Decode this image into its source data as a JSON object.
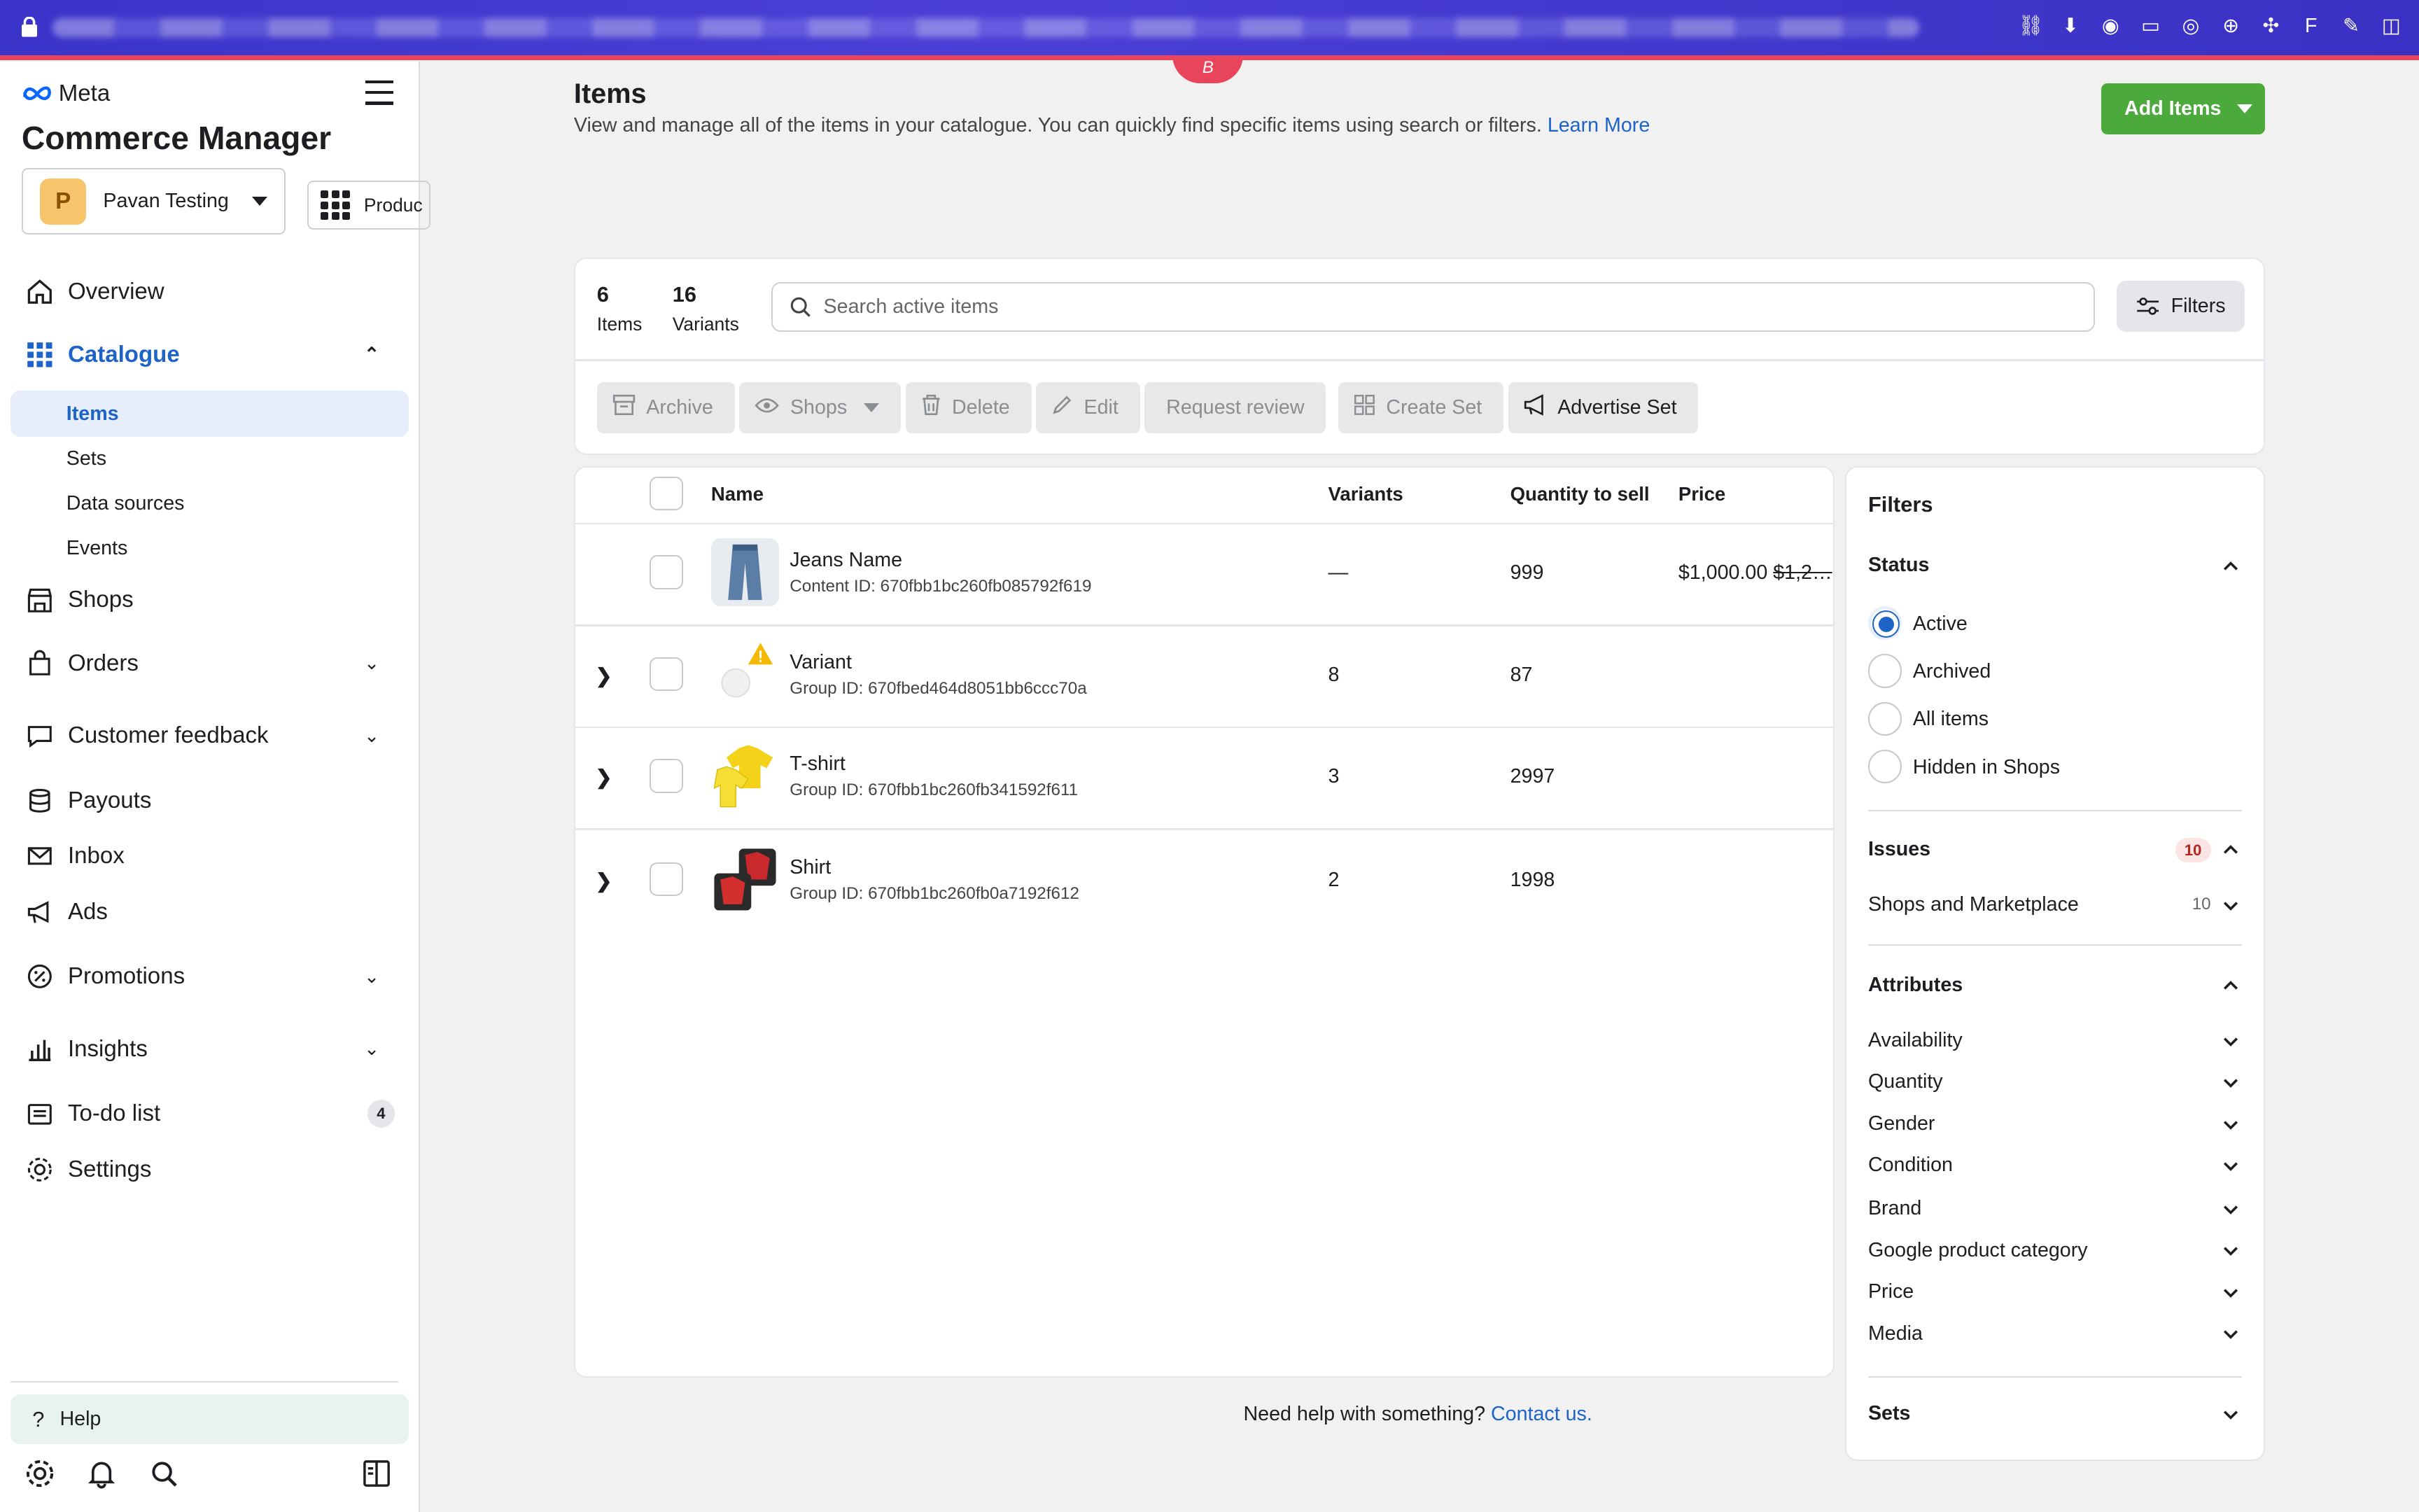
{
  "browser": {
    "notch_label": "B"
  },
  "sidebar": {
    "brand": "Meta",
    "app_title": "Commerce Manager",
    "account": {
      "initial": "P",
      "name": "Pavan Testing"
    },
    "product_switch": "Produc",
    "nav": [
      {
        "label": "Overview"
      },
      {
        "label": "Catalogue"
      },
      {
        "label": "Shops"
      },
      {
        "label": "Orders"
      },
      {
        "label": "Customer feedback"
      },
      {
        "label": "Payouts"
      },
      {
        "label": "Inbox"
      },
      {
        "label": "Ads"
      },
      {
        "label": "Promotions"
      },
      {
        "label": "Insights"
      },
      {
        "label": "To-do list",
        "badge": "4"
      },
      {
        "label": "Settings"
      }
    ],
    "catalogue_sub": [
      "Items",
      "Sets",
      "Data sources",
      "Events"
    ],
    "help": "Help"
  },
  "page": {
    "title": "Items",
    "description": "View and manage all of the items in your catalogue. You can quickly find specific items using search or filters.",
    "learn_more": "Learn More",
    "add_items": "Add Items"
  },
  "summary": {
    "items_count": "6",
    "items_label": "Items",
    "variants_count": "16",
    "variants_label": "Variants",
    "search_placeholder": "Search active items",
    "filters_button": "Filters"
  },
  "actions": [
    "Archive",
    "Shops",
    "Delete",
    "Edit",
    "Request review",
    "Create Set",
    "Advertise Set"
  ],
  "table": {
    "headers": {
      "name": "Name",
      "variants": "Variants",
      "quantity": "Quantity to sell",
      "price": "Price"
    },
    "rows": [
      {
        "name": "Jeans Name",
        "sub": "Content ID: 670fbb1bc260fb085792f619",
        "variants": "—",
        "quantity": "999",
        "price": "$1,000.00",
        "old_price": "$1,2…"
      },
      {
        "name": "Variant",
        "sub": "Group ID: 670fbed464d8051bb6ccc70a",
        "variants": "8",
        "quantity": "87",
        "price": "",
        "old_price": ""
      },
      {
        "name": "T-shirt",
        "sub": "Group ID: 670fbb1bc260fb341592f611",
        "variants": "3",
        "quantity": "2997",
        "price": "",
        "old_price": ""
      },
      {
        "name": "Shirt",
        "sub": "Group ID: 670fbb1bc260fb0a7192f612",
        "variants": "2",
        "quantity": "1998",
        "price": "",
        "old_price": ""
      }
    ]
  },
  "footer": {
    "help_text": "Need help with something?",
    "contact": "Contact us."
  },
  "filters_panel": {
    "title": "Filters",
    "status": {
      "label": "Status",
      "options": [
        "Active",
        "Archived",
        "All items",
        "Hidden in Shops"
      ],
      "selected": "Active"
    },
    "issues": {
      "label": "Issues",
      "badge": "10",
      "items": [
        {
          "label": "Shops and Marketplace",
          "count": "10"
        }
      ]
    },
    "attributes": {
      "label": "Attributes",
      "items": [
        "Availability",
        "Quantity",
        "Gender",
        "Condition",
        "Brand",
        "Google product category",
        "Price",
        "Media"
      ]
    },
    "sets": {
      "label": "Sets"
    }
  },
  "colors": {
    "accent": "#1d63c8",
    "add_button": "#4ca93b",
    "topbar": "#3b34c9",
    "alert": "#e8455d"
  }
}
